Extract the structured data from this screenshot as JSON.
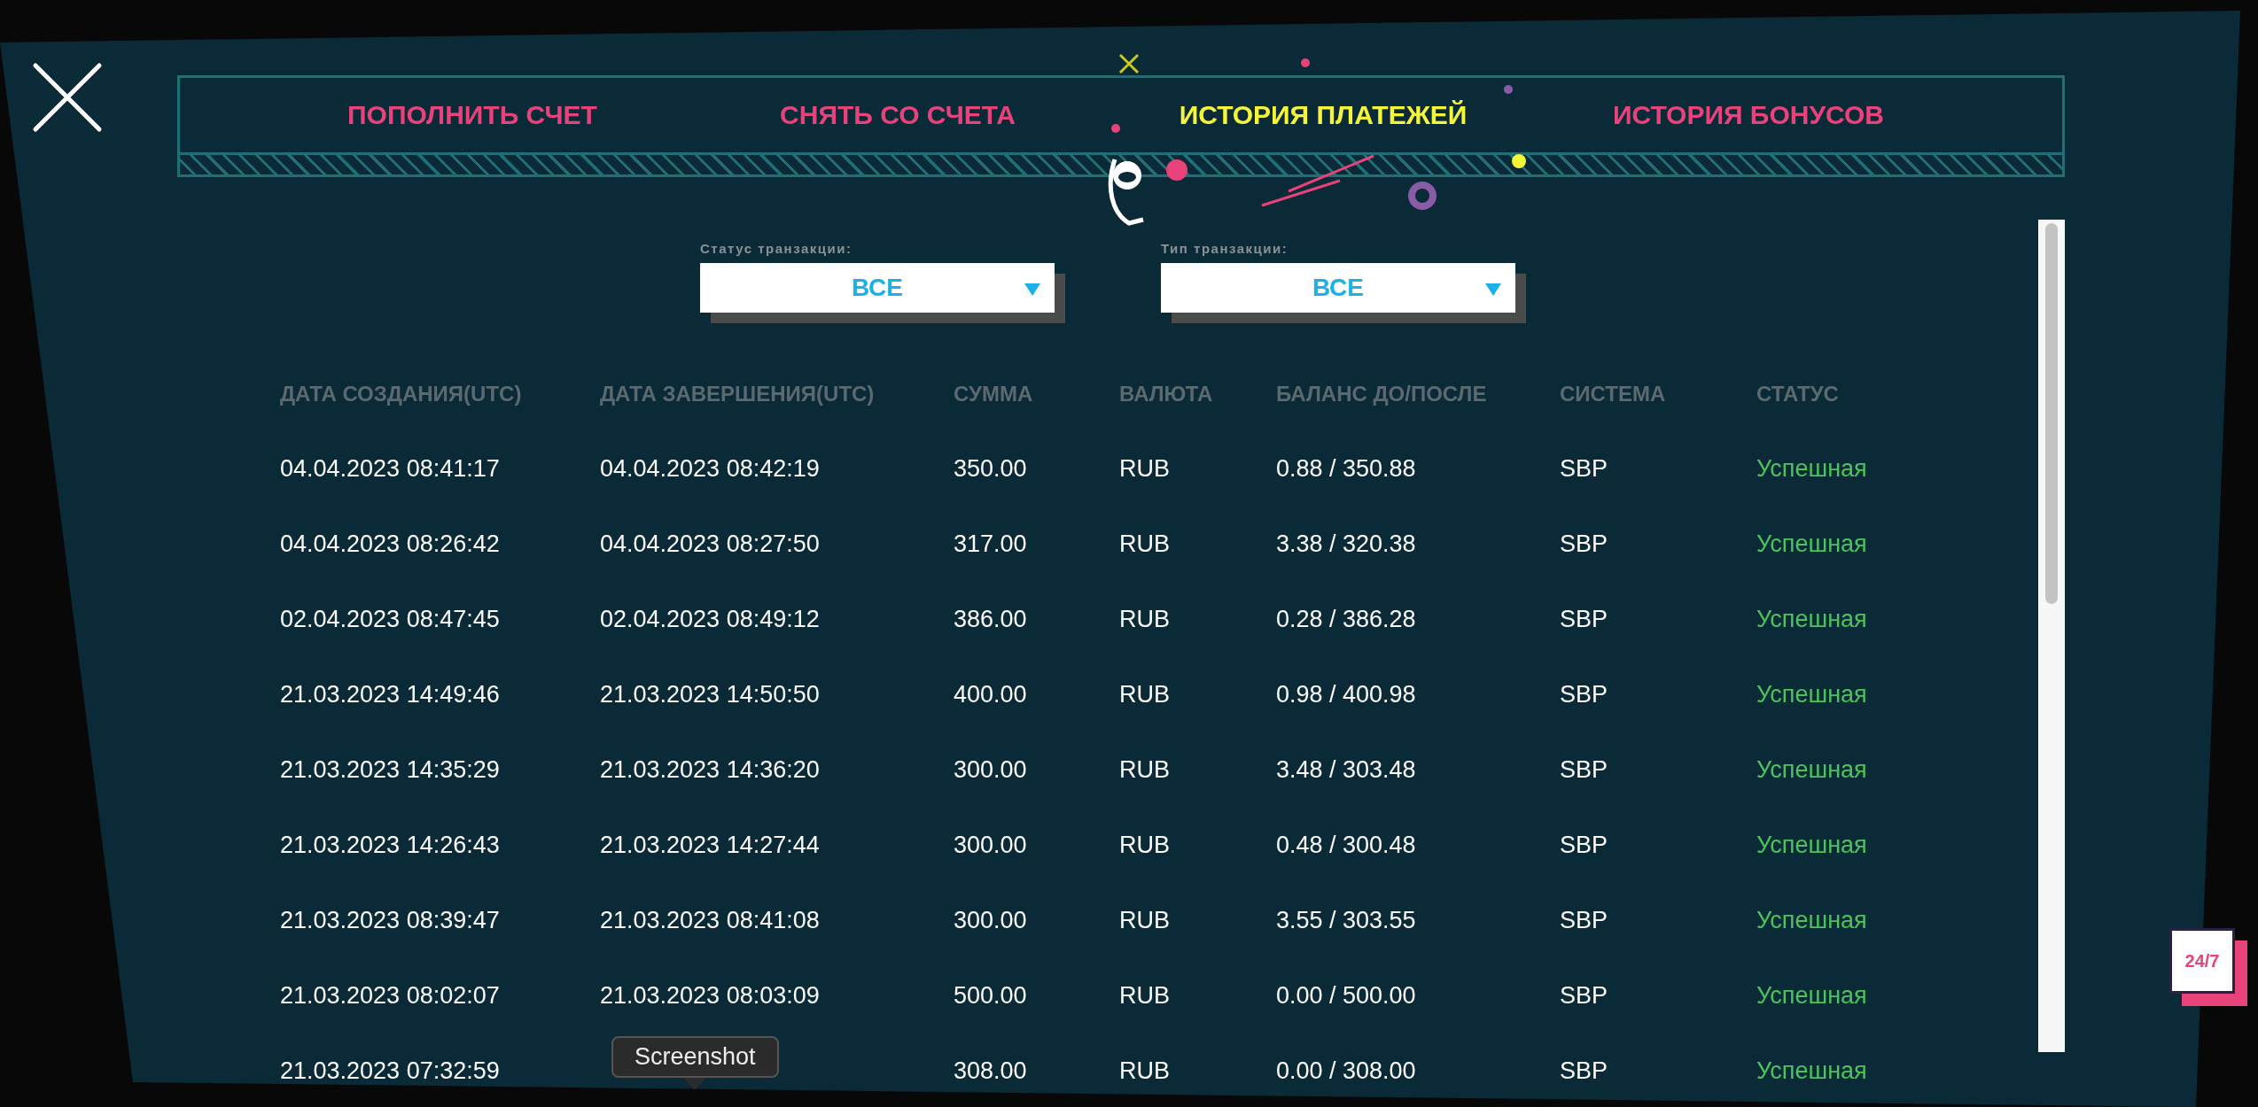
{
  "tabs": [
    {
      "label": "ПОПОЛНИТЬ СЧЕТ",
      "selected": false
    },
    {
      "label": "СНЯТЬ СО СЧЕТА",
      "selected": false
    },
    {
      "label": "ИСТОРИЯ ПЛАТЕЖЕЙ",
      "selected": true
    },
    {
      "label": "ИСТОРИЯ БОНУСОВ",
      "selected": false
    }
  ],
  "filters": [
    {
      "label": "Статус транзакции:",
      "value": "ВСЕ"
    },
    {
      "label": "Тип транзакции:",
      "value": "ВСЕ"
    }
  ],
  "table": {
    "columns": [
      "ДАТА СОЗДАНИЯ(UTC)",
      "ДАТА ЗАВЕРШЕНИЯ(UTC)",
      "СУММА",
      "ВАЛЮТА",
      "БАЛАНС ДО/ПОСЛЕ",
      "СИСТЕМА",
      "СТАТУС"
    ],
    "rows": [
      {
        "created": "04.04.2023 08:41:17",
        "completed": "04.04.2023 08:42:19",
        "amount": "350.00",
        "currency": "RUB",
        "balance": "0.88 / 350.88",
        "system": "SBP",
        "status": "Успешная",
        "color": "#4cc35e"
      },
      {
        "created": "04.04.2023 08:26:42",
        "completed": "04.04.2023 08:27:50",
        "amount": "317.00",
        "currency": "RUB",
        "balance": "3.38 / 320.38",
        "system": "SBP",
        "status": "Успешная",
        "color": "#4cc35e"
      },
      {
        "created": "02.04.2023 08:47:45",
        "completed": "02.04.2023 08:49:12",
        "amount": "386.00",
        "currency": "RUB",
        "balance": "0.28 / 386.28",
        "system": "SBP",
        "status": "Успешная",
        "color": "#4cc35e"
      },
      {
        "created": "21.03.2023 14:49:46",
        "completed": "21.03.2023 14:50:50",
        "amount": "400.00",
        "currency": "RUB",
        "balance": "0.98 / 400.98",
        "system": "SBP",
        "status": "Успешная",
        "color": "#4cc35e"
      },
      {
        "created": "21.03.2023 14:35:29",
        "completed": "21.03.2023 14:36:20",
        "amount": "300.00",
        "currency": "RUB",
        "balance": "3.48 / 303.48",
        "system": "SBP",
        "status": "Успешная",
        "color": "#4cc35e"
      },
      {
        "created": "21.03.2023 14:26:43",
        "completed": "21.03.2023 14:27:44",
        "amount": "300.00",
        "currency": "RUB",
        "balance": "0.48 / 300.48",
        "system": "SBP",
        "status": "Успешная",
        "color": "#4cc35e"
      },
      {
        "created": "21.03.2023 08:39:47",
        "completed": "21.03.2023 08:41:08",
        "amount": "300.00",
        "currency": "RUB",
        "balance": "3.55 / 303.55",
        "system": "SBP",
        "status": "Успешная",
        "color": "#4cc35e"
      },
      {
        "created": "21.03.2023 08:02:07",
        "completed": "21.03.2023 08:03:09",
        "amount": "500.00",
        "currency": "RUB",
        "balance": "0.00 / 500.00",
        "system": "SBP",
        "status": "Успешная",
        "color": "#4cc35e"
      },
      {
        "created": "21.03.2023 07:32:59",
        "amount": "308.00",
        "currency": "RUB",
        "balance": "0.00 / 308.00",
        "system": "SBP",
        "status": "Успешная",
        "color": "#4cc35e"
      }
    ]
  },
  "support_badge": "24/7",
  "tooltip": "Screenshot"
}
